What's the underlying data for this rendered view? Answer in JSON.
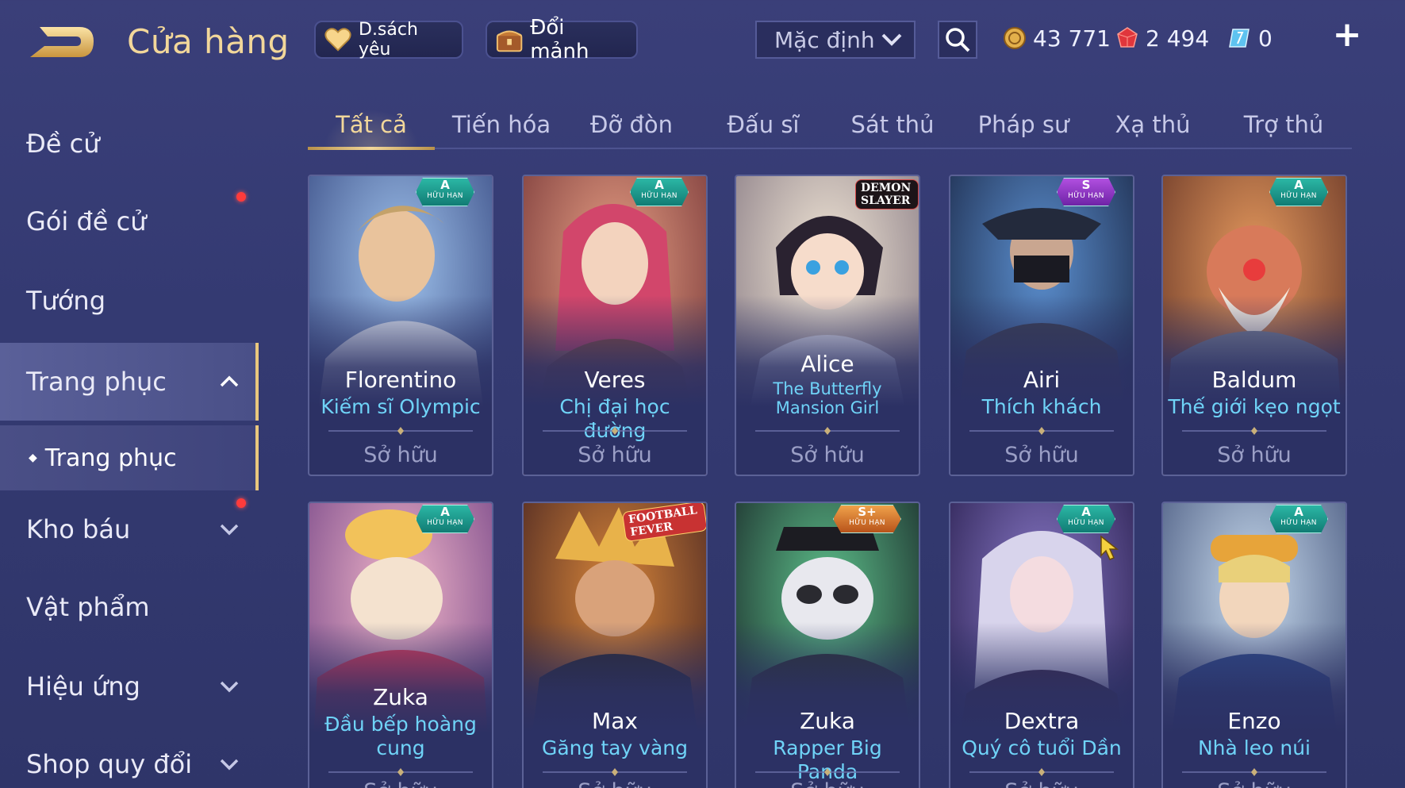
{
  "header": {
    "title": "Cửa hàng",
    "favorites_label": "D.sách yêu",
    "shard_label": "Đổi mảnh",
    "sort_selected": "Mặc định",
    "currencies": [
      {
        "name": "gold-coins",
        "value": "43 771"
      },
      {
        "name": "ruby",
        "value": "2 494"
      },
      {
        "name": "voucher",
        "value": "0"
      }
    ],
    "plus_label": "+"
  },
  "sidebar": {
    "items": [
      {
        "label": "Đề cử"
      },
      {
        "label": "Gói đề cử"
      },
      {
        "label": "Tướng"
      },
      {
        "label": "Trang phục"
      },
      {
        "label": "Kho báu"
      },
      {
        "label": "Vật phẩm"
      },
      {
        "label": "Hiệu ứng"
      },
      {
        "label": "Shop quy đổi"
      }
    ],
    "sub_item": {
      "label": "Trang phục"
    }
  },
  "tabs": [
    {
      "label": "Tất cả",
      "active": true
    },
    {
      "label": "Tiến hóa"
    },
    {
      "label": "Đỡ đòn"
    },
    {
      "label": "Đấu sĩ"
    },
    {
      "label": "Sát thủ"
    },
    {
      "label": "Pháp sư"
    },
    {
      "label": "Xạ thủ"
    },
    {
      "label": "Trợ thủ"
    }
  ],
  "cards": [
    {
      "hero": "Florentino",
      "skin": "Kiếm sĩ Olympic",
      "status": "Sở hữu",
      "badge_rank": "A",
      "badge_text": "HỮU HẠN",
      "art_color": "#6b8ec9"
    },
    {
      "hero": "Veres",
      "skin": "Chị đại học đường",
      "status": "Sở hữu",
      "badge_rank": "A",
      "badge_text": "HỮU HẠN",
      "art_color": "#c5665a"
    },
    {
      "hero": "Alice",
      "skin": "The Butterfly Mansion Girl",
      "status": "Sở hữu",
      "event_logo": "DEMON SLAYER",
      "art_color": "#d7c6b6"
    },
    {
      "hero": "Airi",
      "skin": "Thích khách",
      "status": "Sở hữu",
      "badge_rank": "S",
      "badge_text": "HỮU HẠN",
      "art_color": "#3c5c8e"
    },
    {
      "hero": "Baldum",
      "skin": "Thế giới kẹo ngọt",
      "status": "Sở hữu",
      "badge_rank": "A",
      "badge_text": "HỮU HẠN",
      "art_color": "#b0623a"
    },
    {
      "hero": "Zuka",
      "skin": "Đầu bếp hoàng cung",
      "status": "Sở hữu",
      "badge_rank": "A",
      "badge_text": "HỮU HẠN",
      "art_color": "#d48a5a"
    },
    {
      "hero": "Max",
      "skin": "Găng tay vàng",
      "status": "Sở hữu",
      "event_logo": "FOOTBALL FEVER",
      "art_color": "#a4502e"
    },
    {
      "hero": "Zuka",
      "skin": "Rapper Big Panda",
      "status": "Sở hữu",
      "badge_rank": "S+",
      "badge_text": "HỮU HẠN",
      "art_color": "#3d6e58"
    },
    {
      "hero": "Dextra",
      "skin": "Quý cô tuổi Dần",
      "status": "Sở hữu",
      "badge_rank": "A",
      "badge_text": "HỮU HẠN",
      "art_color": "#6a4e96"
    },
    {
      "hero": "Enzo",
      "skin": "Nhà leo núi",
      "status": "Sở hữu",
      "badge_rank": "A",
      "badge_text": "HỮU HẠN",
      "art_color": "#8ea7c7"
    }
  ],
  "colors": {
    "accent_gold": "#f2d79a",
    "skin_name_cyan": "#6fd3f7",
    "background": "#363c76",
    "notification_red": "#ff3b3b"
  }
}
